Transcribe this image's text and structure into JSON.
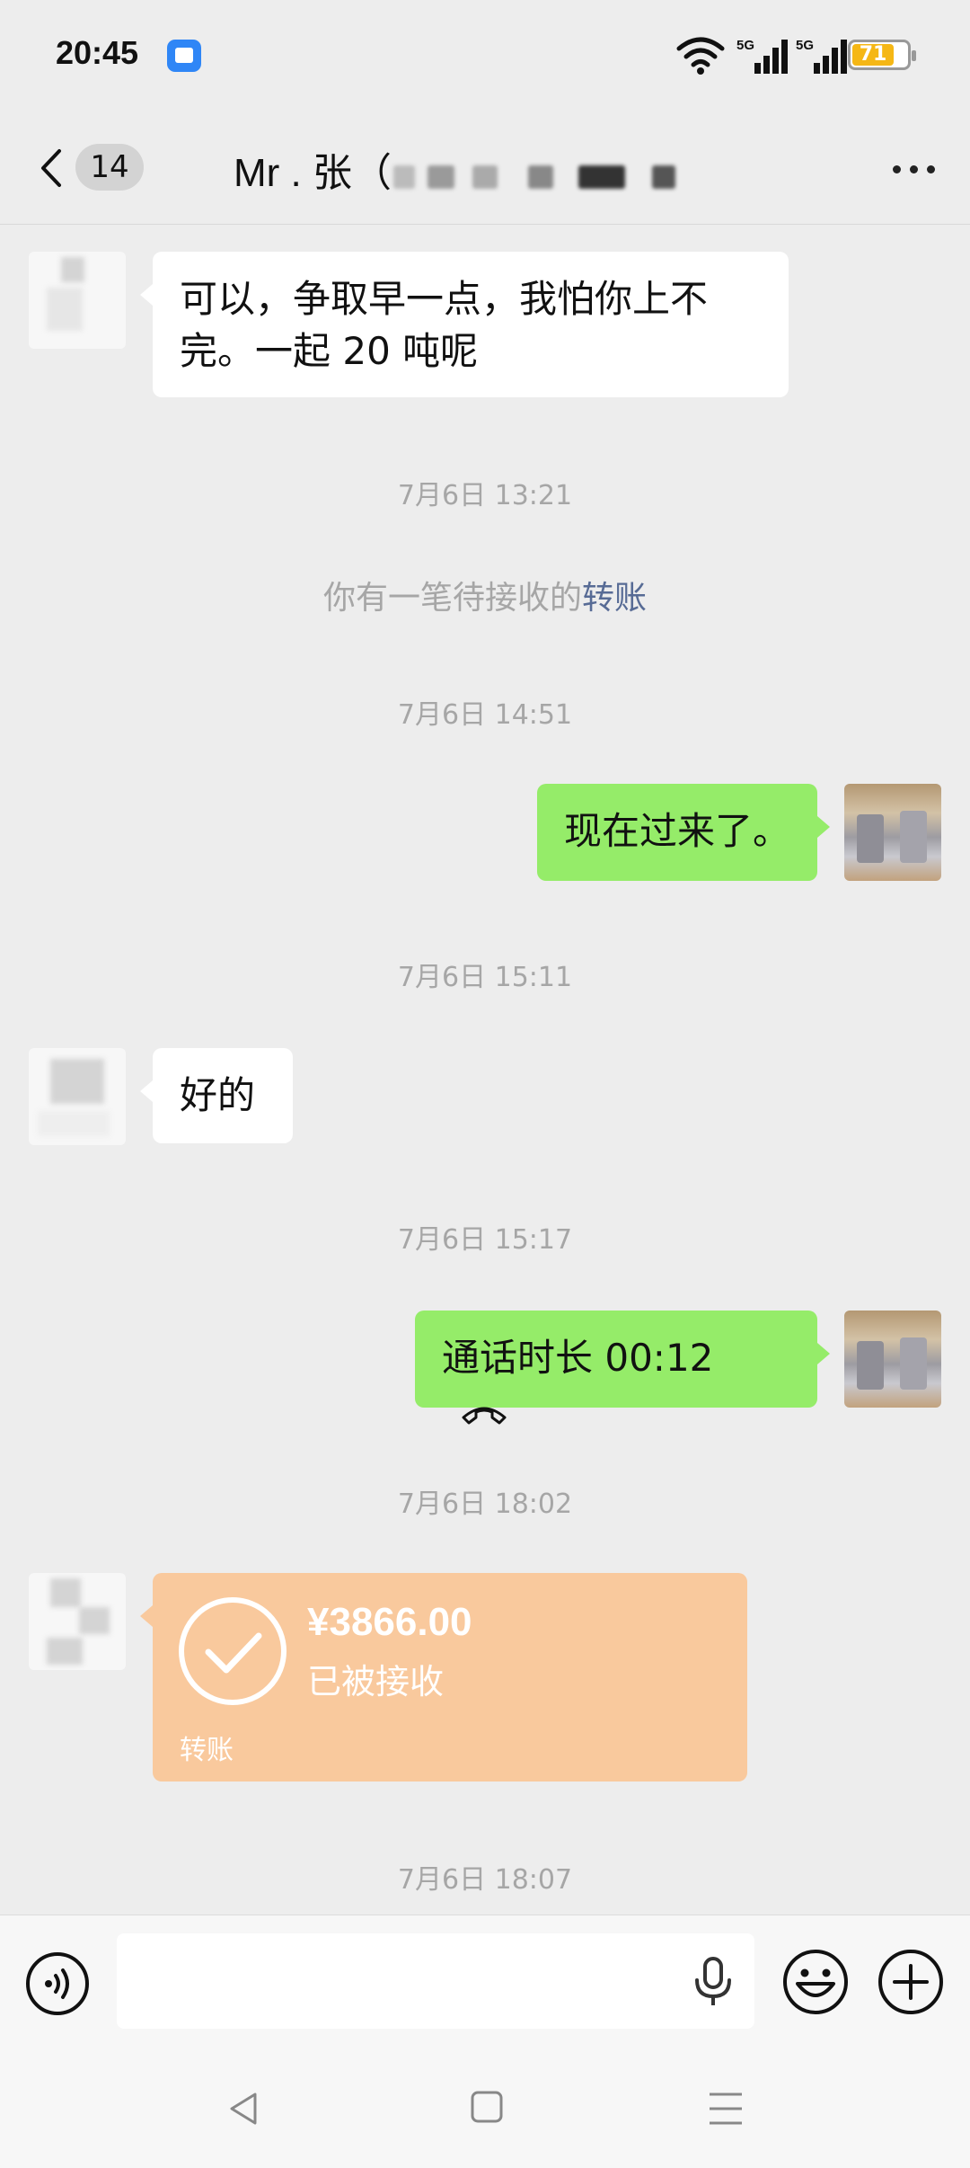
{
  "status_bar": {
    "time": "20:45",
    "battery": "71",
    "network_1": "5G",
    "network_2": "5G"
  },
  "header": {
    "unread_count": "14",
    "title": "Mr . 张（"
  },
  "messages": [
    {
      "type": "received",
      "text_line1": "可以，争取早一点，我怕你上不",
      "text_line2": "完。一起 20 吨呢"
    },
    {
      "type": "timestamp",
      "text": "7月6日 13:21"
    },
    {
      "type": "system",
      "text": "你有一笔待接收的",
      "link": "转账"
    },
    {
      "type": "timestamp",
      "text": "7月6日 14:51"
    },
    {
      "type": "sent",
      "text": "现在过来了。"
    },
    {
      "type": "timestamp",
      "text": "7月6日 15:11"
    },
    {
      "type": "received",
      "text": "好的"
    },
    {
      "type": "timestamp",
      "text": "7月6日 15:17"
    },
    {
      "type": "sent_call",
      "text": "通话时长 00:12"
    },
    {
      "type": "timestamp",
      "text": "7月6日 18:02"
    },
    {
      "type": "transfer",
      "amount": "¥3866.00",
      "status": "已被接收",
      "label": "转账"
    },
    {
      "type": "timestamp",
      "text": "7月6日 18:07"
    }
  ],
  "input_bar": {
    "placeholder": ""
  },
  "icons": {
    "voice": "voice-mode-icon",
    "mic": "microphone-icon",
    "emoji": "emoji-icon",
    "plus": "plus-icon",
    "back": "chevron-left-icon",
    "more": "more-dots-icon",
    "call": "hang-up-phone-icon",
    "check": "check-circle-icon"
  },
  "colors": {
    "sent_bubble": "#95ec69",
    "received_bubble": "#ffffff",
    "transfer_card": "#f9c99d",
    "link": "#576b95",
    "background": "#ededed"
  }
}
